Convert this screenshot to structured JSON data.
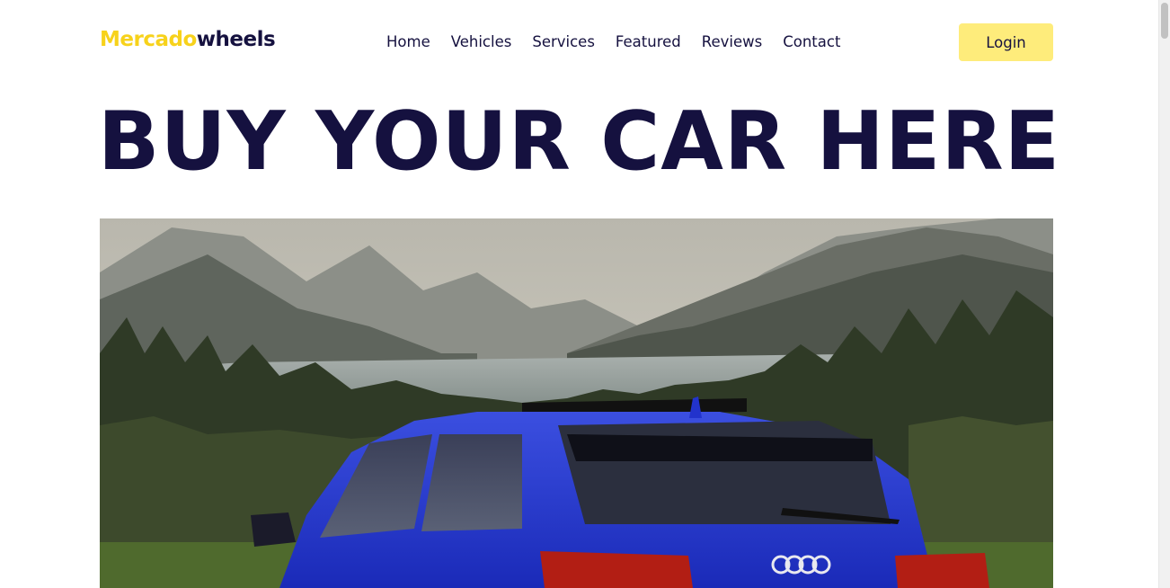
{
  "header": {
    "logo_part1": "Mercado",
    "logo_part2": "wheels",
    "nav": [
      "Home",
      "Vehicles",
      "Services",
      "Featured",
      "Reviews",
      "Contact"
    ],
    "login_label": "Login"
  },
  "hero": {
    "title": "BUY YOUR CAR HERE",
    "image_icon": "car-landscape-photo"
  },
  "colors": {
    "brand_yellow": "#f7d21b",
    "brand_navy": "#15113f",
    "button_yellow": "#feec7b",
    "car_blue": "#2a3fd6"
  }
}
